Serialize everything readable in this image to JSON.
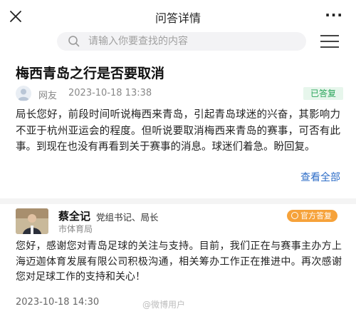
{
  "header": {
    "title": "问答详情",
    "more_label": "···"
  },
  "search": {
    "placeholder": "请输入你要查找的内容"
  },
  "question": {
    "title": "梅西青岛之行是否要取消",
    "asker_name": "网友",
    "time": "2023-10-18 13:38",
    "status": "已答复",
    "status_color": "#2aa55a",
    "body": "局长您好，前段时间听说梅西来青岛，引起青岛球迷的兴奋，其影响力不亚于杭州亚运会的程度。但听说要取消梅西来青岛的赛事，可否有此事。到现在也没有再看到关于赛事的消息。球迷们着急。盼回复。",
    "view_all": "查看全部"
  },
  "answer": {
    "name": "蔡全记",
    "role": "党组书记、局长",
    "org": "市体育局",
    "badge": "官方答复",
    "badge_color": "#f6a23a",
    "body": "您好，感谢您对青岛足球的关注与支持。目前，我们正在与赛事主办方上海迈迦体育发展有限公司积极沟通，相关筹办工作正在推进中。再次感谢您对足球工作的支持和关心！",
    "time": "2023-10-18 14:30"
  },
  "watermark": "@微博用户",
  "icons": [
    "close-icon",
    "more-icon",
    "search-icon",
    "menu-icon",
    "user-avatar",
    "official-badge-icon"
  ],
  "colors": {
    "link": "#2d6dc7",
    "text": "#222222",
    "meta": "#888888"
  }
}
